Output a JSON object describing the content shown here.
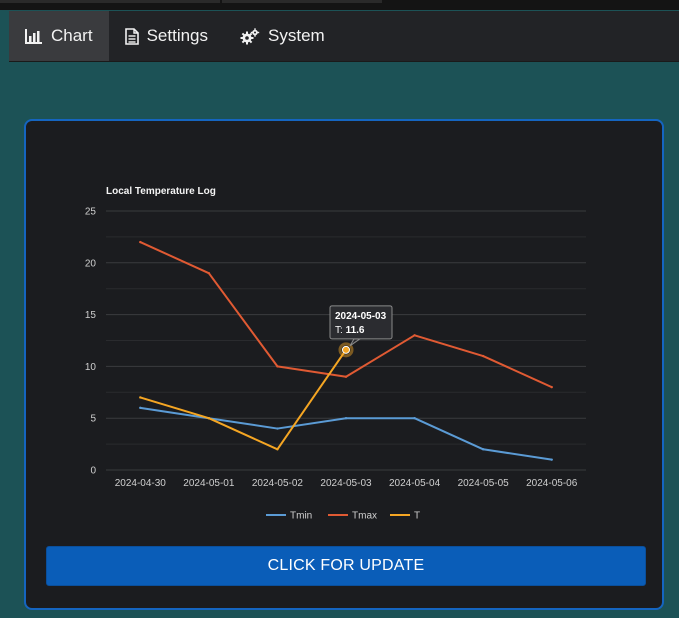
{
  "nav": {
    "tabs": [
      {
        "label": "Chart",
        "icon": "bar-chart-icon",
        "active": true
      },
      {
        "label": "Settings",
        "icon": "document-icon",
        "active": false
      },
      {
        "label": "System",
        "icon": "gears-icon",
        "active": false
      }
    ]
  },
  "colors": {
    "background": "#1c5256",
    "card": "#1b1c1f",
    "card_border": "#1565c0",
    "button": "#0a5db8",
    "Tmin": "#5b9bd5",
    "Tmax": "#e05a33",
    "T": "#f5a623"
  },
  "chart_data": {
    "type": "line",
    "title": "Local Temperature Log",
    "x": [
      "2024-04-30",
      "2024-05-01",
      "2024-05-02",
      "2024-05-03",
      "2024-05-04",
      "2024-05-05",
      "2024-05-06"
    ],
    "ylim": [
      0,
      25
    ],
    "yticks": [
      0,
      5,
      10,
      15,
      20,
      25
    ],
    "grid": true,
    "legend_position": "bottom",
    "series": [
      {
        "name": "Tmin",
        "values": [
          6,
          5,
          4,
          5,
          5,
          2,
          1
        ]
      },
      {
        "name": "Tmax",
        "values": [
          22,
          19,
          10,
          9,
          13,
          11,
          8
        ]
      },
      {
        "name": "T",
        "values": [
          7,
          5,
          2,
          11.6,
          null,
          null,
          null
        ]
      }
    ],
    "tooltip": {
      "title": "2024-05-03",
      "label": "T:",
      "value": "11.6",
      "series": "T",
      "index": 3
    }
  },
  "button": {
    "label": "CLICK FOR UPDATE"
  }
}
